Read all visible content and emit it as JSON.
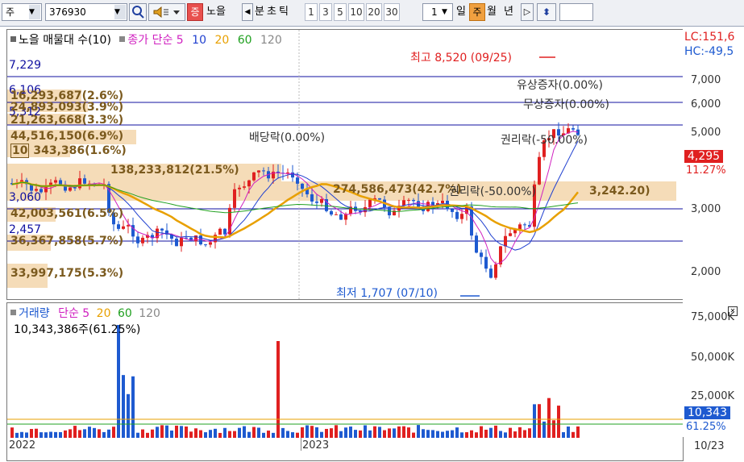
{
  "toolbar": {
    "market": "주",
    "code": "376930",
    "icon_search": "search-icon",
    "icon_sound": "speaker-icon",
    "badge": "증",
    "name": "노을",
    "period_prev": "◀",
    "period_labels": [
      "분",
      "초",
      "틱"
    ],
    "periods": [
      "1",
      "3",
      "5",
      "10",
      "20",
      "30"
    ],
    "interval_value": "1",
    "period_types": [
      "일",
      "주",
      "월",
      "년"
    ],
    "period_next": "▷",
    "updown": "⬍",
    "active_period": "주"
  },
  "price_panel": {
    "legend_stock": "노을 매물대 수(10)",
    "legend_ma": "종가 단순 5",
    "ma_periods": [
      "10",
      "20",
      "60",
      "120"
    ],
    "ma_colors": [
      "#d020c0",
      "#2040d0",
      "#f0a000",
      "#20a020",
      "#888888"
    ],
    "left_levels": [
      "7,229",
      "6,106",
      "5,312",
      "3,060",
      "2,457"
    ],
    "volume_profile": [
      "16,293,687(2.6%)",
      "24,893,093(3.9%)",
      "21,263,668(3.3%)",
      "44,516,150(6.9%)",
      "343,386(1.6%)",
      "138,233,812(21.5%)",
      "274,586,473(42.7%)",
      "42,003,561(6.5%)",
      "36,367,858(5.7%)",
      "33,997,175(5.3%)"
    ],
    "volume_profile_marker": "10",
    "annotations": {
      "high": "최고 8,520 (09/25)",
      "low": "최저 1,707 (07/10)",
      "dividend": "배당락(0.00%)",
      "paid_in": "유상증자(0.00%)",
      "bonus": "무상증자(0.00%)",
      "rights": "권리락(-50.00%)",
      "rights2": "권리락(-50.00%)",
      "value_tag": "3,242.20)"
    },
    "right_top": [
      "LC:151,6",
      "HC:-49,5"
    ],
    "y_ticks": [
      "7,000",
      "6,000",
      "5,000",
      "3,000",
      "2,000"
    ],
    "current_price": "4,295",
    "current_pct": "11.27%"
  },
  "volume_panel": {
    "legend": "거래량",
    "legend_ma": "단순 5",
    "ma_periods": [
      "20",
      "60",
      "120"
    ],
    "last_volume": "10,343,386주(61.25%)",
    "y_ticks": [
      "75,000K",
      "50,000K",
      "25,000K"
    ],
    "current_vol": "10,343",
    "current_vol_pct": "61.25%"
  },
  "x_axis": {
    "labels": [
      "2022",
      "2023"
    ],
    "right_date": "10/23"
  },
  "colors": {
    "up": "#e02020",
    "down": "#1e5ad0",
    "ma5": "#d020c0",
    "ma10": "#2040d0",
    "ma20": "#e8a000",
    "ma60": "#20a020",
    "ma120": "#999999",
    "level": "#1010a0",
    "profile": "#f5dcb8"
  }
}
